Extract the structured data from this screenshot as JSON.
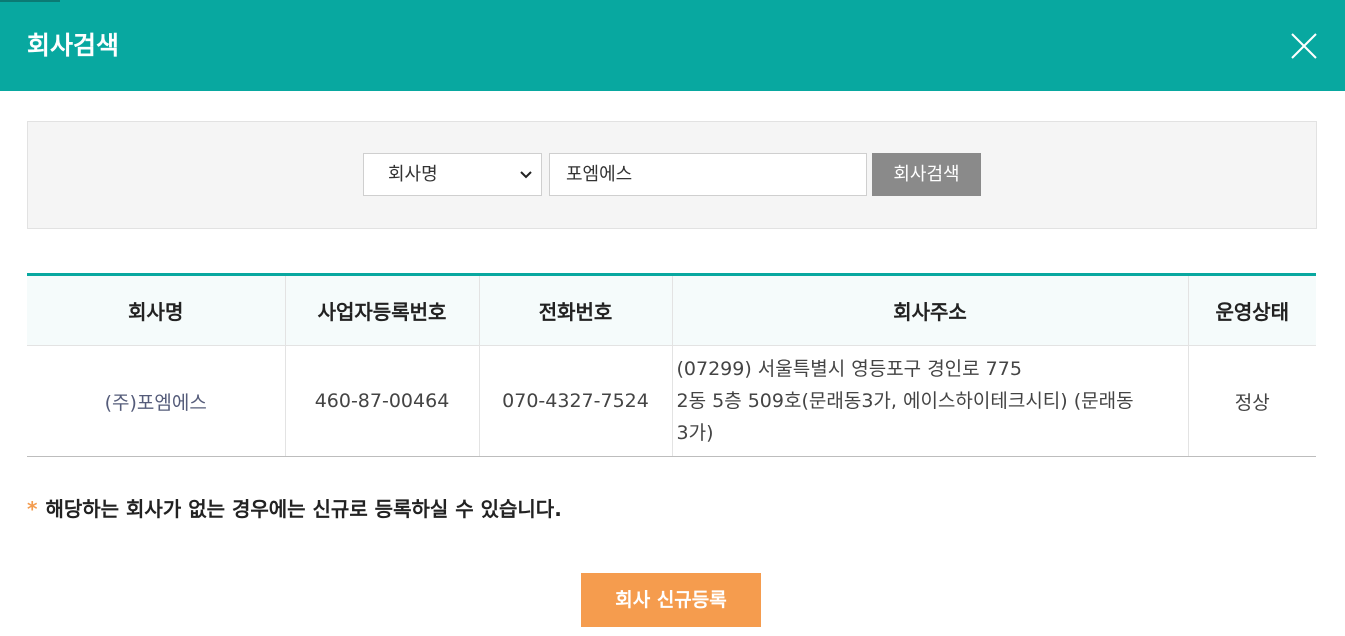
{
  "header": {
    "title": "회사검색",
    "close_icon": "close-icon"
  },
  "search": {
    "select_value": "회사명",
    "input_value": "포엠에스",
    "button_label": "회사검색"
  },
  "table": {
    "columns": [
      "회사명",
      "사업자등록번호",
      "전화번호",
      "회사주소",
      "운영상태"
    ],
    "rows": [
      {
        "company": "(주)포엠에스",
        "biz_no": "460-87-00464",
        "phone": "070-4327-7524",
        "address_line1": "(07299) 서울특별시 영등포구 경인로 775",
        "address_line2": "2동 5층 509호(문래동3가, 에이스하이테크시티) (문래동",
        "address_line3": "3가)",
        "status": "정상"
      }
    ]
  },
  "notice": {
    "star": "*",
    "text": "해당하는 회사가 없는 경우에는 신규로 등록하실 수 있습니다."
  },
  "register": {
    "button_label": "회사 신규등록"
  },
  "colors": {
    "header_bg": "#08a8a0",
    "search_btn": "#8a8a8a",
    "register_btn": "#f59c4e",
    "star": "#f39c4f"
  }
}
